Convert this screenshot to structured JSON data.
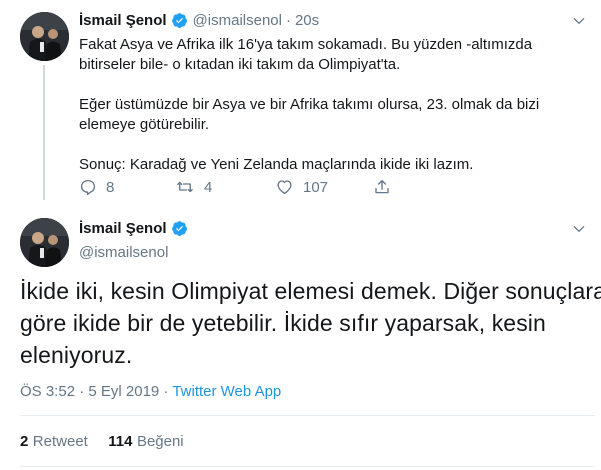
{
  "tweet1": {
    "name": "İsmail Şenol",
    "handle": "@ismailsenol",
    "separator": "·",
    "time": "20s",
    "paragraphs": [
      "Fakat Asya ve Afrika ilk 16'ya takım sokamadı. Bu yüzden -altımızda",
      "bitirseler bile- o kıtadan iki takım da Olimpiyat'ta.",
      "Eğer üstümüzde bir Asya ve bir Afrika takımı olursa, 23. olmak da bizi",
      "elemeye götürebilir.",
      "Sonuç: Karadağ ve Yeni Zelanda maçlarında ikide iki lazım."
    ],
    "actions": {
      "reply_count": "8",
      "retweet_count": "4",
      "like_count": "107"
    }
  },
  "tweet2": {
    "name": "İsmail Şenol",
    "handle": "@ismailsenol",
    "text_lines": [
      "İkide iki, kesin Olimpiyat elemesi demek. Diğer sonuçlara",
      "göre ikide bir de yetebilir. İkide sıfır yaparsak, kesin",
      "eleniyoruz."
    ],
    "timestamp": "ÖS 3:52 · 5 Eyl 2019 ·",
    "source": "Twitter Web App",
    "stats": {
      "retweets_num": "2",
      "retweets_label": "Retweet",
      "likes_num": "114",
      "likes_label": "Beğeni"
    }
  },
  "colors": {
    "verified": "#1da1f2",
    "link": "#1b95e0",
    "muted": "#657786"
  },
  "icons": [
    "verified-badge-icon",
    "chevron-down-icon",
    "reply-icon",
    "retweet-icon",
    "like-icon",
    "share-icon"
  ]
}
